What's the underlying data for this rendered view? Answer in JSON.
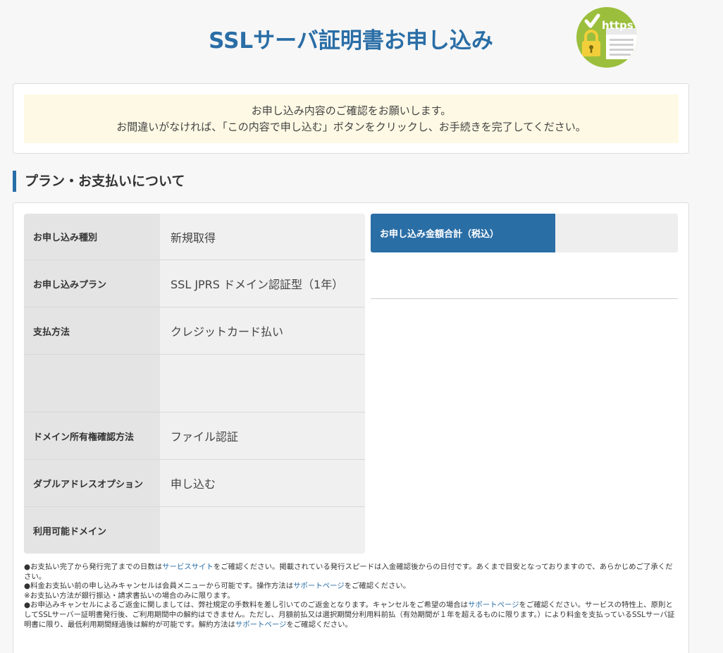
{
  "header": {
    "title": "SSLサーバ証明書お申し込み",
    "badge_text": "https"
  },
  "notice": {
    "line1": "お申し込み内容のご確認をお願いします。",
    "line2": "お間違いがなければ、「この内容で申し込む」ボタンをクリックし、お手続きを完了してください。"
  },
  "section": {
    "heading": "プラン・お支払いについて"
  },
  "details": {
    "rows": [
      {
        "label": "お申し込み種別",
        "value": "新規取得"
      },
      {
        "label": "お申し込みプラン",
        "value": "SSL JPRS ドメイン認証型（1年）"
      },
      {
        "label": "支払方法",
        "value": "クレジットカード払い"
      },
      {
        "label": "",
        "value": ""
      },
      {
        "label": "ドメイン所有権確認方法",
        "value": "ファイル認証"
      },
      {
        "label": "ダブルアドレスオプション",
        "value": "申し込む"
      },
      {
        "label": "利用可能ドメイン",
        "value": ""
      }
    ]
  },
  "total": {
    "label": "お申し込み金額合計（税込）",
    "value": ""
  },
  "notes": {
    "n1_a": "●お支払い完了から発行完了までの日数は",
    "n1_link": "サービスサイト",
    "n1_b": "をご確認ください。掲載されている発行スピードは入金確認後からの日付です。あくまで目安となっておりますので、あらかじめご了承ください。",
    "n2_a": "●料金お支払い前の申し込みキャンセルは会員メニューから可能です。操作方法は",
    "n2_link": "サポートページ",
    "n2_b": "をご確認ください。",
    "n3": "※お支払い方法が銀行振込・請求書払いの場合のみに限ります。",
    "n4_a": "●お申込みキャンセルによるご返金に関しましては、弊社規定の手数料を差し引いてのご返金となります。キャンセルをご希望の場合は",
    "n4_link1": "サポートページ",
    "n4_b": "をご確認ください。サービスの特性上、原則としてSSLサーバー証明書発行後、ご利用期間中の解約はできません。ただし、月額前払又は選択期間分利用料前払（有効期間が１年を超えるものに限ります。）により料金を支払っているSSLサーバ証明書に限り、最低利用期間経過後は解約が可能です。解約方法は",
    "n4_link2": "サポートページ",
    "n4_c": "をご確認ください。"
  },
  "colors": {
    "accent": "#2a6ea6",
    "badge_green": "#9bbf3d",
    "lock_yellow": "#f2cf3a",
    "notice_bg": "#fdf9e4"
  }
}
